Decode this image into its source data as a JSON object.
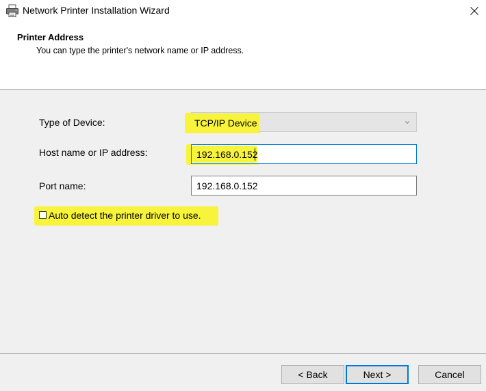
{
  "window": {
    "title": "Network Printer Installation Wizard",
    "icon": "printer-icon",
    "close_icon": "close-icon"
  },
  "header": {
    "title": "Printer Address",
    "subtitle": "You can type the printer's network name or IP address."
  },
  "form": {
    "device_type_label": "Type of Device:",
    "device_type_value": "TCP/IP Device",
    "host_label": "Host name or IP address:",
    "host_value": "192.168.0.152",
    "port_label": "Port name:",
    "port_value": "192.168.0.152",
    "auto_detect_label": "Auto detect the printer driver to use.",
    "auto_detect_checked": false
  },
  "buttons": {
    "back": "< Back",
    "next": "Next >",
    "cancel": "Cancel"
  },
  "colors": {
    "highlight": "#f7f43b",
    "focus": "#0078d7",
    "panel": "#f0f0f0"
  }
}
